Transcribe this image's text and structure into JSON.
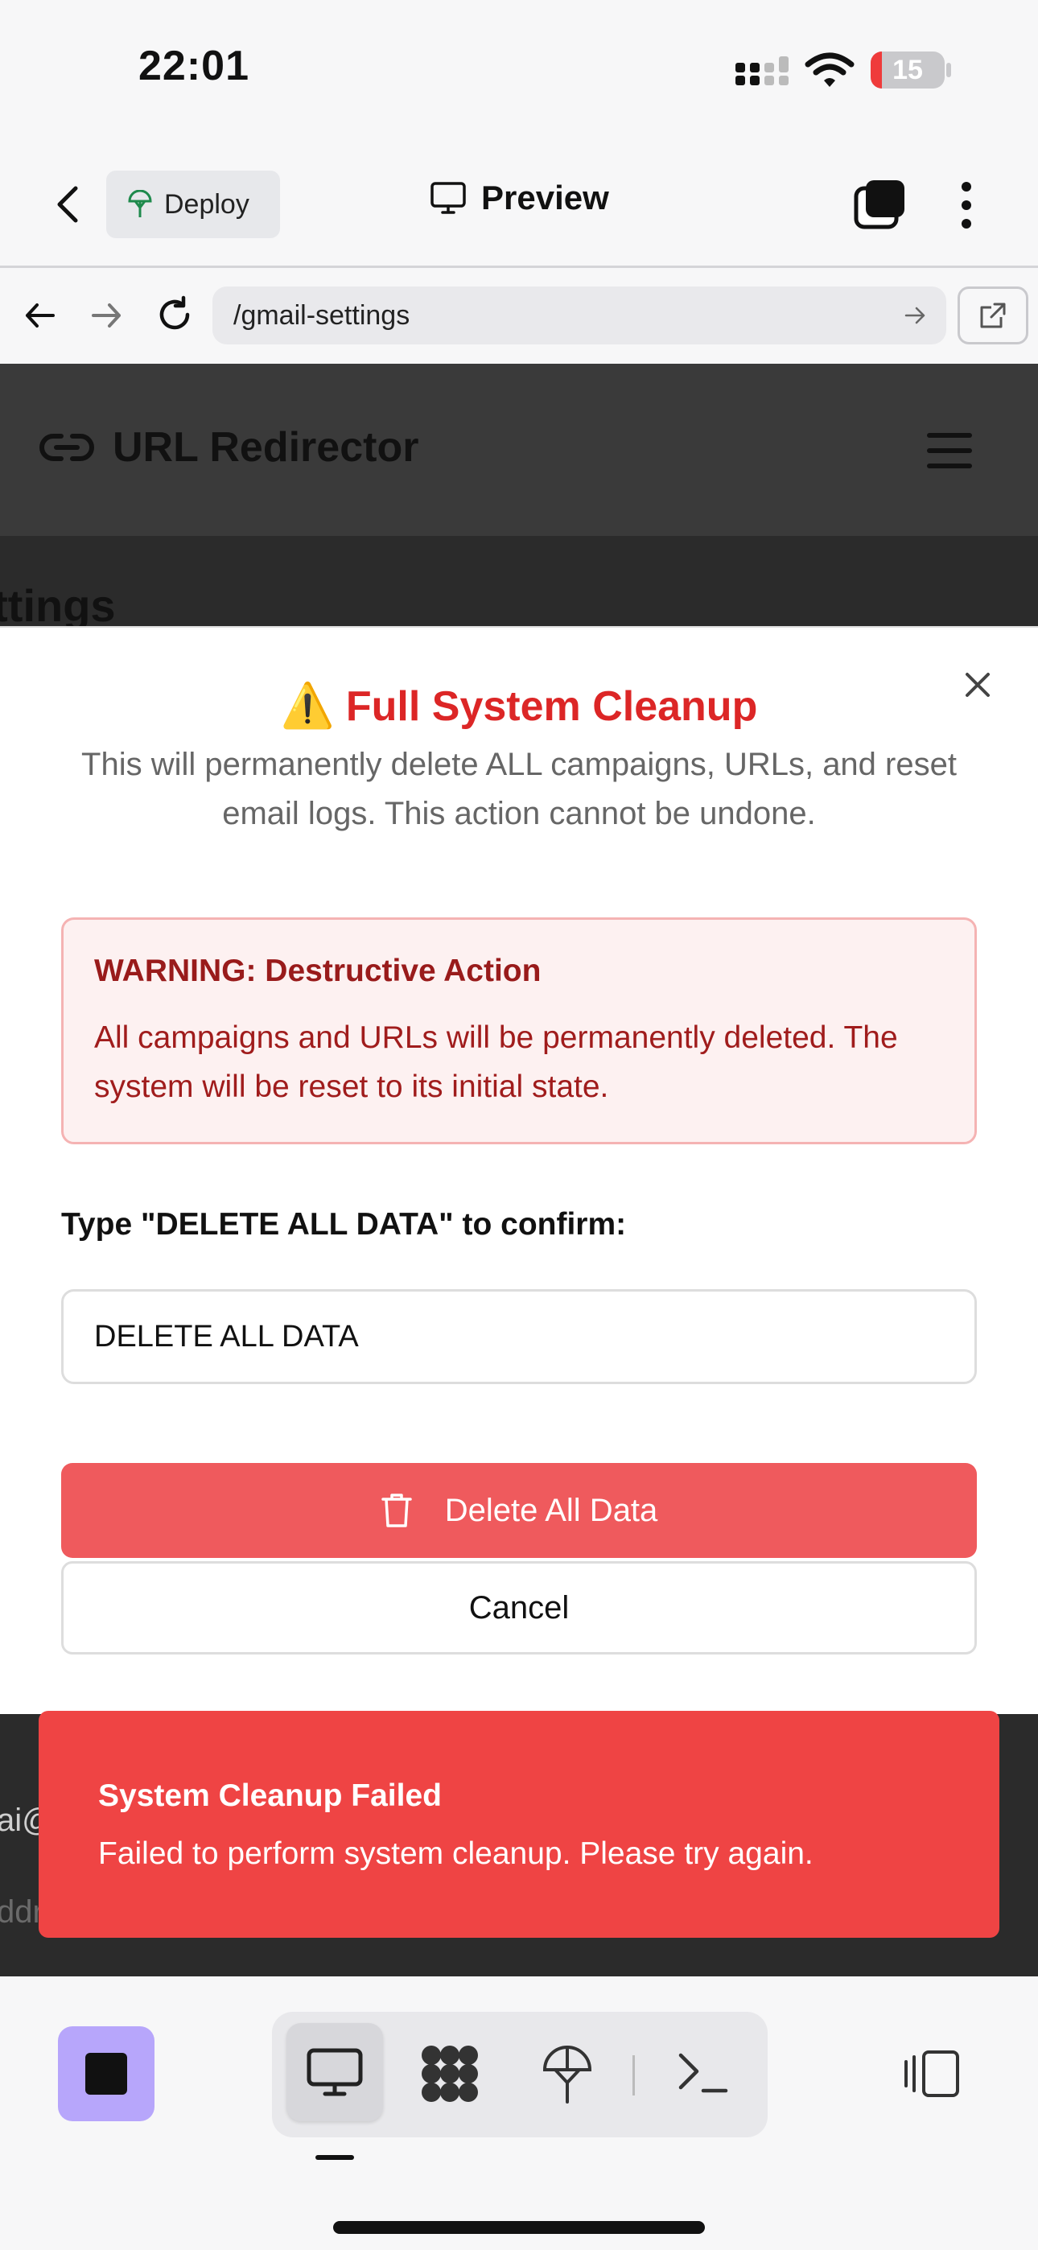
{
  "status_bar": {
    "time": "22:01",
    "battery": "15",
    "battery_level": 0.15
  },
  "app_header": {
    "deploy_label": "Deploy",
    "preview_label": "Preview"
  },
  "browser": {
    "url": "/gmail-settings"
  },
  "page": {
    "brand": "URL Redirector",
    "partial_heading": "ettings",
    "peek_1": "ai@",
    "peek_2": "ddr"
  },
  "modal": {
    "warning_emoji": "⚠️",
    "title": "Full System Cleanup",
    "description": "This will permanently delete ALL campaigns, URLs, and reset email logs. This action cannot be undone.",
    "warning_heading": "WARNING: Destructive Action",
    "warning_body": "All campaigns and URLs will be permanently deleted. The system will be reset to its initial state.",
    "confirm_label": "Type \"DELETE ALL DATA\" to confirm:",
    "confirm_value": "DELETE ALL DATA",
    "delete_button": "Delete All Data",
    "cancel_button": "Cancel"
  },
  "toast": {
    "title": "System Cleanup Failed",
    "body": "Failed to perform system cleanup. Please try again."
  },
  "toolbar": {
    "items": [
      "preview-icon",
      "workspace-icon",
      "deploy-icon",
      "terminal-icon"
    ],
    "active": "preview-icon"
  },
  "colors": {
    "destructive": "#dc2626",
    "delete_button": "#ef5a5d",
    "toast_bg": "#ef4444",
    "stop_button": "#b7a6fb"
  }
}
